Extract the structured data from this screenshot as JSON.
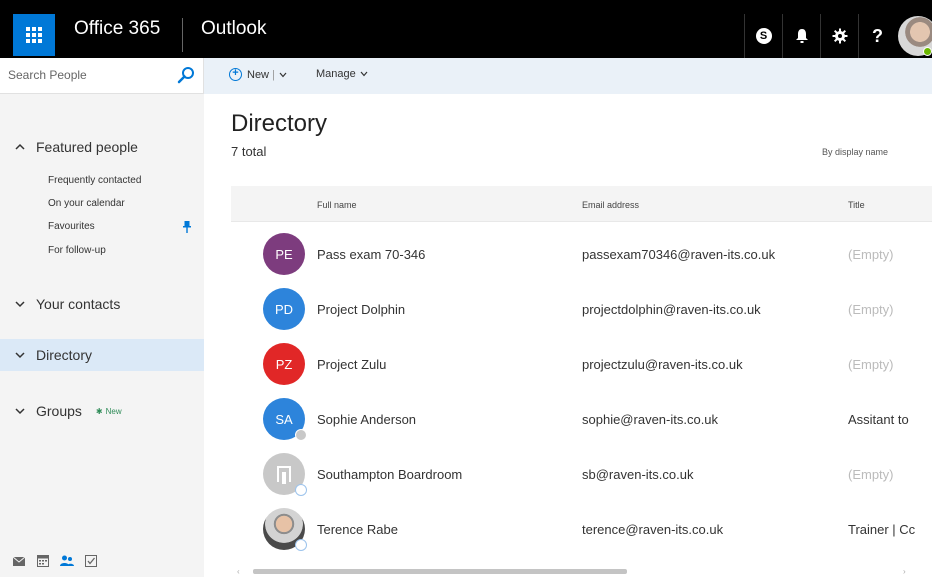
{
  "topbar": {
    "brand": "Office 365",
    "app": "Outlook"
  },
  "search": {
    "placeholder": "Search People"
  },
  "commands": {
    "new_label": "New",
    "new_sep": "|",
    "manage_label": "Manage"
  },
  "nav": {
    "featured": "Featured people",
    "sub": [
      "Frequently contacted",
      "On your calendar",
      "Favourites",
      "For follow-up"
    ],
    "contacts": "Your contacts",
    "directory": "Directory",
    "groups": "Groups",
    "groups_badge": "New"
  },
  "main": {
    "title": "Directory",
    "total": "7 total",
    "sort": "By display name",
    "columns": [
      "Full name",
      "Email address",
      "Title"
    ]
  },
  "rows": [
    {
      "initials": "PE",
      "name": "Pass exam 70-346",
      "email": "passexam70346@raven-its.co.uk",
      "title": "(Empty)",
      "color": "#7d3c7e"
    },
    {
      "initials": "PD",
      "name": "Project Dolphin",
      "email": "projectdolphin@raven-its.co.uk",
      "title": "(Empty)",
      "color": "#2d84db"
    },
    {
      "initials": "PZ",
      "name": "Project Zulu",
      "email": "projectzulu@raven-its.co.uk",
      "title": "(Empty)",
      "color": "#e12727"
    },
    {
      "initials": "SA",
      "name": "Sophie Anderson",
      "email": "sophie@raven-its.co.uk",
      "title": "Assitant to",
      "color": "#2d84db"
    },
    {
      "initials": "",
      "name": "Southampton Boardroom",
      "email": "sb@raven-its.co.uk",
      "title": "(Empty)",
      "color": "#c8c8c8"
    },
    {
      "initials": "",
      "name": "Terence Rabe",
      "email": "terence@raven-its.co.uk",
      "title": "Trainer | Cc",
      "color": "#d3d3d3"
    }
  ],
  "colors": {
    "accent": "#0078d7",
    "topbar": "#000000",
    "sidebar": "#f4f4f4",
    "selected": "#dbe9f7",
    "empty_text": "#bbbbbb"
  }
}
